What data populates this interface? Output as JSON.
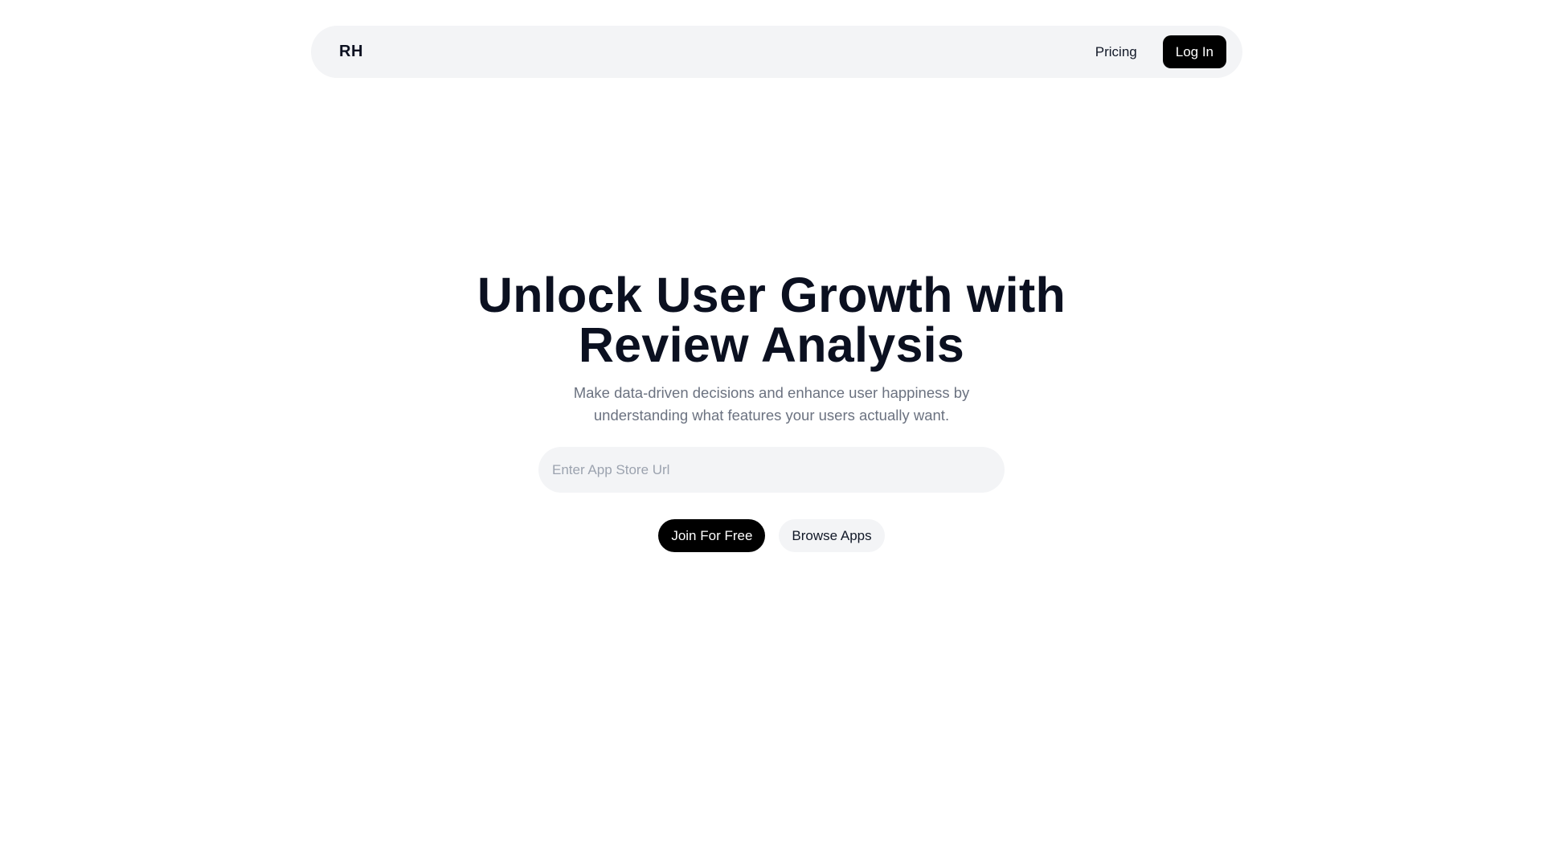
{
  "header": {
    "logo": "RH",
    "nav_pricing": "Pricing",
    "login_label": "Log In"
  },
  "hero": {
    "title": "Unlock User Growth with Review Analysis",
    "subtitle": "Make data-driven decisions and enhance user happiness by understanding what features your users actually want.",
    "input_placeholder": "Enter App Store Url",
    "input_value": "",
    "primary_cta": "Join For Free",
    "secondary_cta": "Browse Apps"
  },
  "colors": {
    "background": "#ffffff",
    "surface": "#f3f4f6",
    "primary_button": "#000000",
    "heading_text": "#0b1020",
    "muted_text": "#6b7280"
  }
}
